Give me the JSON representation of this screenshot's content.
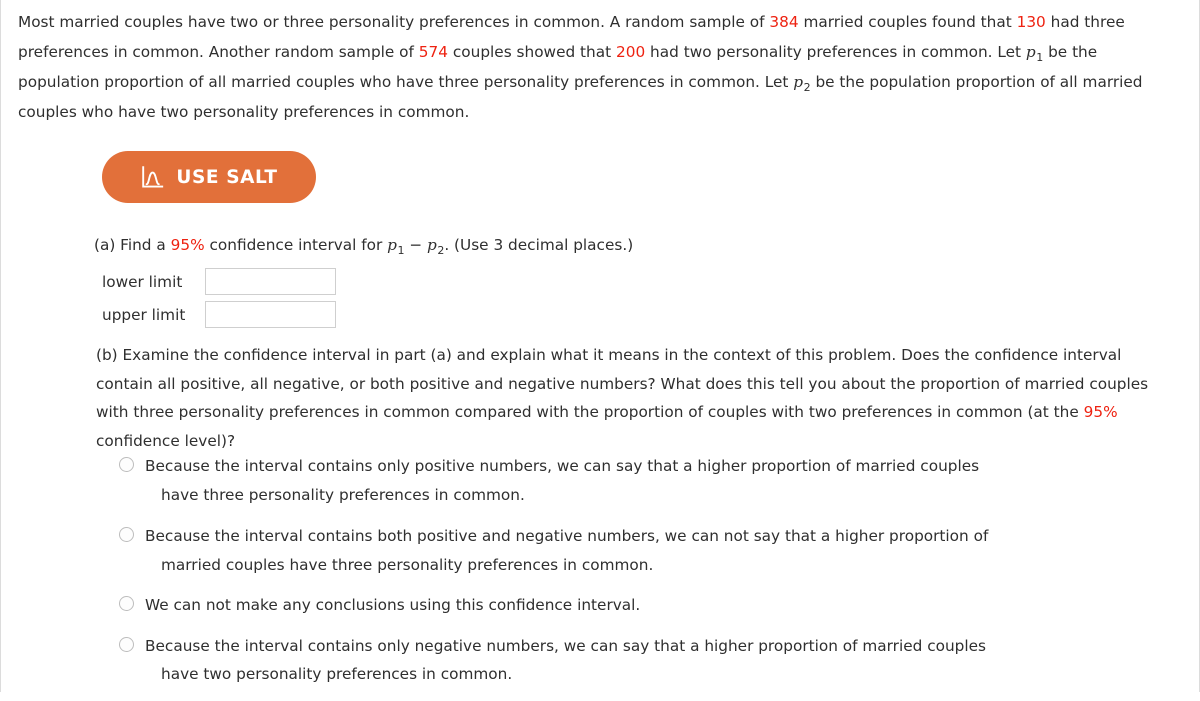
{
  "problem": {
    "sentence1_a": "Most married couples have two or three personality preferences in common. A random sample of ",
    "sample1": "384",
    "sentence1_b": " married couples found that ",
    "count1": "130",
    "sentence1_c": " had three preferences in common. Another random sample of ",
    "sample2": "574",
    "sentence1_d": " couples showed that ",
    "count2": "200",
    "sentence1_e": " had two personality preferences in common. Let ",
    "p1_symbol": "p",
    "p1_sub": "1",
    "sentence1_f": " be the population proportion of all married couples who have three personality preferences in common. Let ",
    "p2_symbol": "p",
    "p2_sub": "2",
    "sentence1_g": " be the population proportion of all married couples who have two personality preferences in common."
  },
  "salt_button": {
    "label": "USE SALT",
    "icon": "distribution-curve-icon",
    "background_color": "#e2703a",
    "text_color": "#ffffff"
  },
  "part_a": {
    "prefix": "(a) Find a ",
    "confidence": "95%",
    "middle": " confidence interval for ",
    "p1_symbol": "p",
    "p1_sub": "1",
    "minus": " − ",
    "p2_symbol": "p",
    "p2_sub": "2",
    "suffix": ". (Use 3 decimal places.)",
    "lower_limit_label": "lower limit",
    "lower_limit_value": "",
    "upper_limit_label": "upper limit",
    "upper_limit_value": ""
  },
  "part_b": {
    "text_before": "(b) Examine the confidence interval in part (a) and explain what it means in the context of this problem. Does the confidence interval contain all positive, all negative, or both positive and negative numbers? What does this tell you about the proportion of married couples with three personality preferences in common compared with the proportion of couples with two preferences in common (at the ",
    "confidence": "95%",
    "text_after": " confidence level)?",
    "options": [
      {
        "line1": "Because the interval contains only positive numbers, we can say that a higher proportion of married couples",
        "line2": "have three personality preferences in common.",
        "selected": false
      },
      {
        "line1": "Because the interval contains both positive and negative numbers, we can not say that a higher proportion of",
        "line2": "married couples have three personality preferences in common.",
        "selected": false
      },
      {
        "line1": "We can not make any conclusions using this confidence interval.",
        "line2": "",
        "selected": false
      },
      {
        "line1": "Because the interval contains only negative numbers, we can say that a higher proportion of married couples",
        "line2": "have two personality preferences in common.",
        "selected": false
      }
    ]
  },
  "colors": {
    "accent_red": "#ee2211",
    "salt_orange": "#e2703a",
    "text": "#2f2f2f",
    "border": "#cfcfcf"
  }
}
